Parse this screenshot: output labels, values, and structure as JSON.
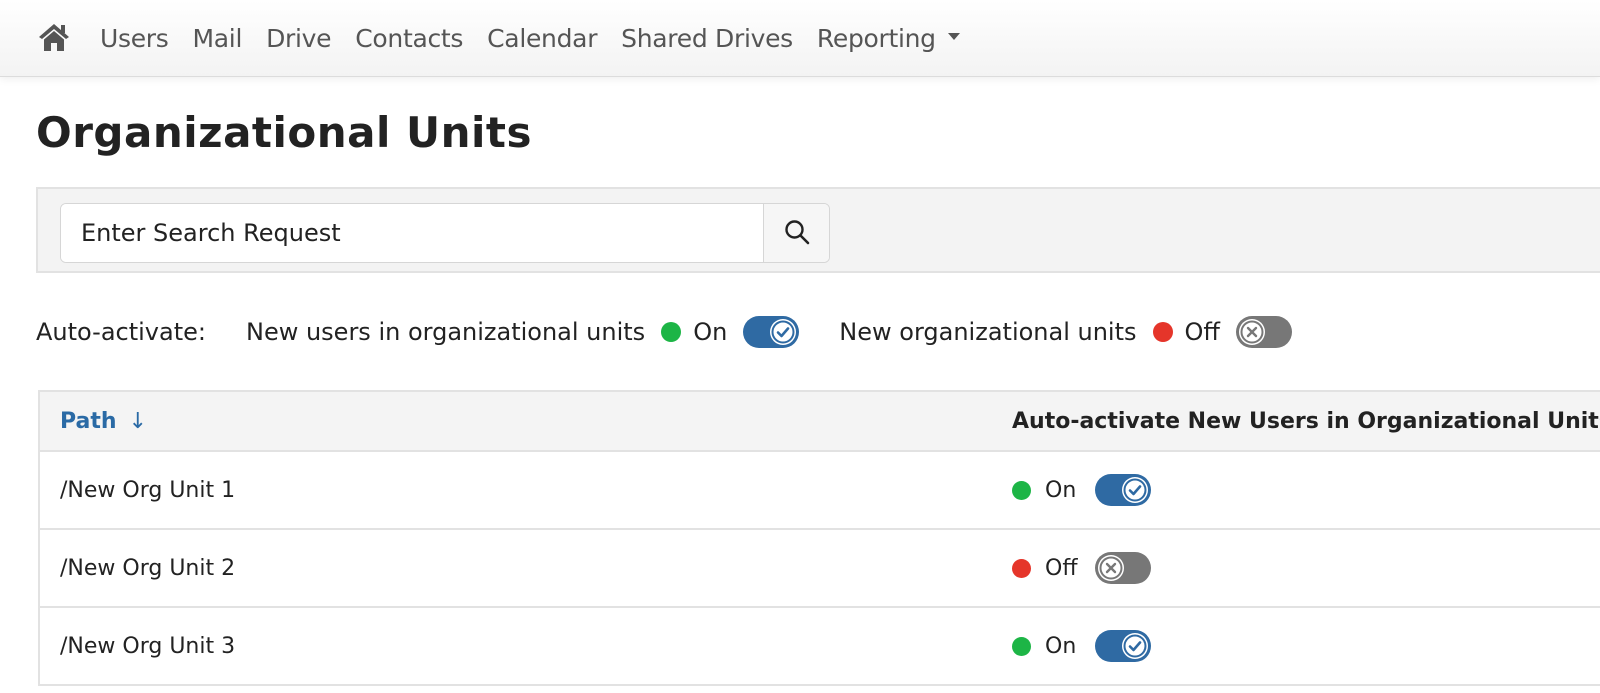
{
  "nav": {
    "home_icon": "home-icon",
    "links": [
      "Users",
      "Mail",
      "Drive",
      "Contacts",
      "Calendar",
      "Shared Drives"
    ],
    "dropdown": "Reporting"
  },
  "page": {
    "title": "Organizational Units"
  },
  "search": {
    "placeholder": "Enter Search Request",
    "value": "",
    "button_icon": "search-icon"
  },
  "auto_activate": {
    "label": "Auto-activate:",
    "settings": [
      {
        "label": "New users in organizational units",
        "state": "On",
        "enabled": true
      },
      {
        "label": "New organizational units",
        "state": "Off",
        "enabled": false
      }
    ]
  },
  "table": {
    "columns": {
      "path": "Path",
      "path_sort": "↓",
      "auto": "Auto-activate New Users in Organizational Units"
    },
    "rows": [
      {
        "path": "/New Org Unit 1",
        "state": "On",
        "enabled": true
      },
      {
        "path": "/New Org Unit 2",
        "state": "Off",
        "enabled": false
      },
      {
        "path": "/New Org Unit 3",
        "state": "On",
        "enabled": true
      }
    ]
  },
  "colors": {
    "on_dot": "#1db546",
    "off_dot": "#e5352a",
    "toggle_on": "#2f6aa3",
    "toggle_off": "#777777",
    "link": "#2a6aa5"
  }
}
